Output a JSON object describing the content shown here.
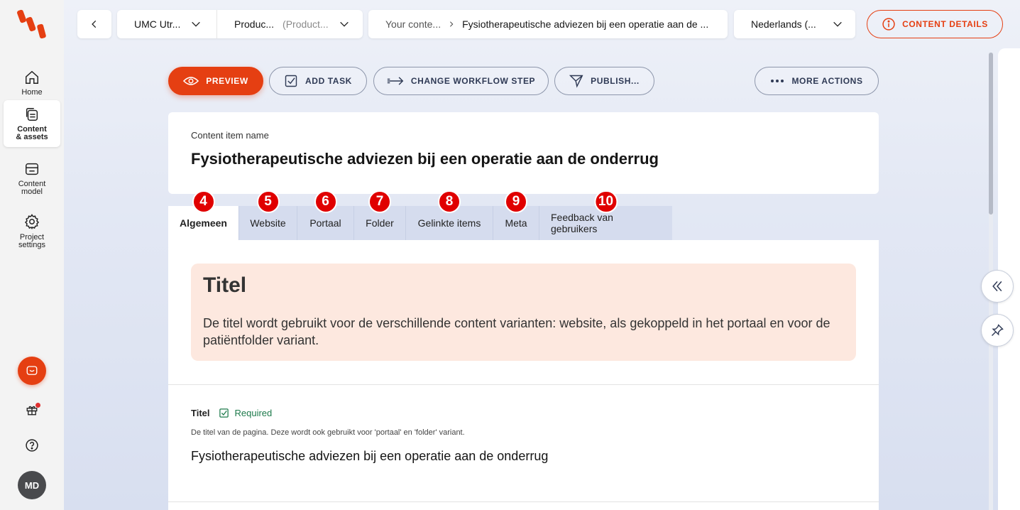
{
  "nav": {
    "items": [
      {
        "label": "Home"
      },
      {
        "label": "Content\n& assets"
      },
      {
        "label": "Content\nmodel"
      },
      {
        "label": "Project\nsettings"
      }
    ],
    "avatar_initials": "MD"
  },
  "topbar": {
    "back_icon": "chevron-left-icon",
    "project": "UMC Utr...",
    "environment": "Produc...",
    "environment_muted": "(Product...",
    "breadcrumb_root": "Your conte...",
    "breadcrumb_current": "Fysiotherapeutische adviezen bij een operatie aan de ...",
    "language": "Nederlands (...",
    "details_label": "CONTENT DETAILS"
  },
  "actions": {
    "preview": "PREVIEW",
    "add_task": "ADD TASK",
    "change_workflow": "CHANGE WORKFLOW STEP",
    "publish": "PUBLISH...",
    "more": "MORE ACTIONS"
  },
  "content": {
    "name_label": "Content item name",
    "name": "Fysiotherapeutische adviezen bij een operatie aan de onderrug"
  },
  "tabs": [
    {
      "label": "Algemeen",
      "badge": "4"
    },
    {
      "label": "Website",
      "badge": "5"
    },
    {
      "label": "Portaal",
      "badge": "6"
    },
    {
      "label": "Folder",
      "badge": "7"
    },
    {
      "label": "Gelinkte items",
      "badge": "8"
    },
    {
      "label": "Meta",
      "badge": "9"
    },
    {
      "label": "Feedback van gebruikers",
      "badge": "10"
    }
  ],
  "guide": {
    "title": "Titel",
    "text": "De titel wordt gebruikt voor de verschillende content varianten: website, als gekoppeld in het portaal en voor de patiëntfolder variant."
  },
  "field": {
    "label": "Titel",
    "required": "Required",
    "help": "De titel van de pagina. Deze wordt ook gebruikt voor 'portaal' en 'folder' variant.",
    "value": "Fysiotherapeutische adviezen bij een operatie aan de onderrug"
  },
  "colors": {
    "accent": "#e53f12",
    "badge": "#e00000",
    "guide_bg": "#fde8df",
    "required": "#1d7a4b"
  }
}
